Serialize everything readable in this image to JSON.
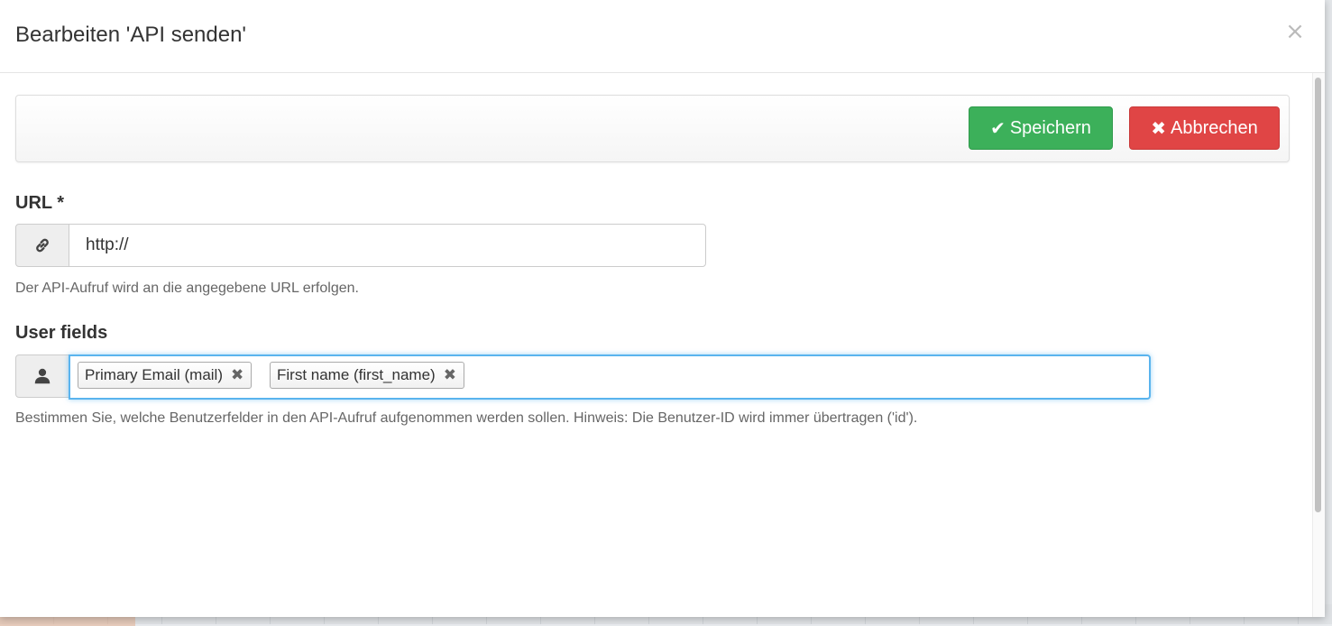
{
  "modal": {
    "title": "Bearbeiten 'API senden'",
    "close_icon": "close-icon"
  },
  "toolbar": {
    "save_label": "Speichern",
    "save_icon": "checkmark-icon",
    "cancel_label": "Abbrechen",
    "cancel_icon": "x-icon",
    "save_color": "#3cb05a",
    "cancel_color": "#e04545"
  },
  "url_field": {
    "label": "URL *",
    "icon": "link-icon",
    "value": "http://",
    "help": "Der API-Aufruf wird an die angegebene URL erfolgen."
  },
  "user_fields": {
    "label": "User fields",
    "icon": "user-icon",
    "tags": [
      {
        "label": "Primary Email (mail)"
      },
      {
        "label": "First name (first_name)"
      }
    ],
    "help": "Bestimmen Sie, welche Benutzerfelder in den API-Aufruf aufgenommen werden sollen. Hinweis: Die Benutzer-ID wird immer übertragen ('id')."
  }
}
